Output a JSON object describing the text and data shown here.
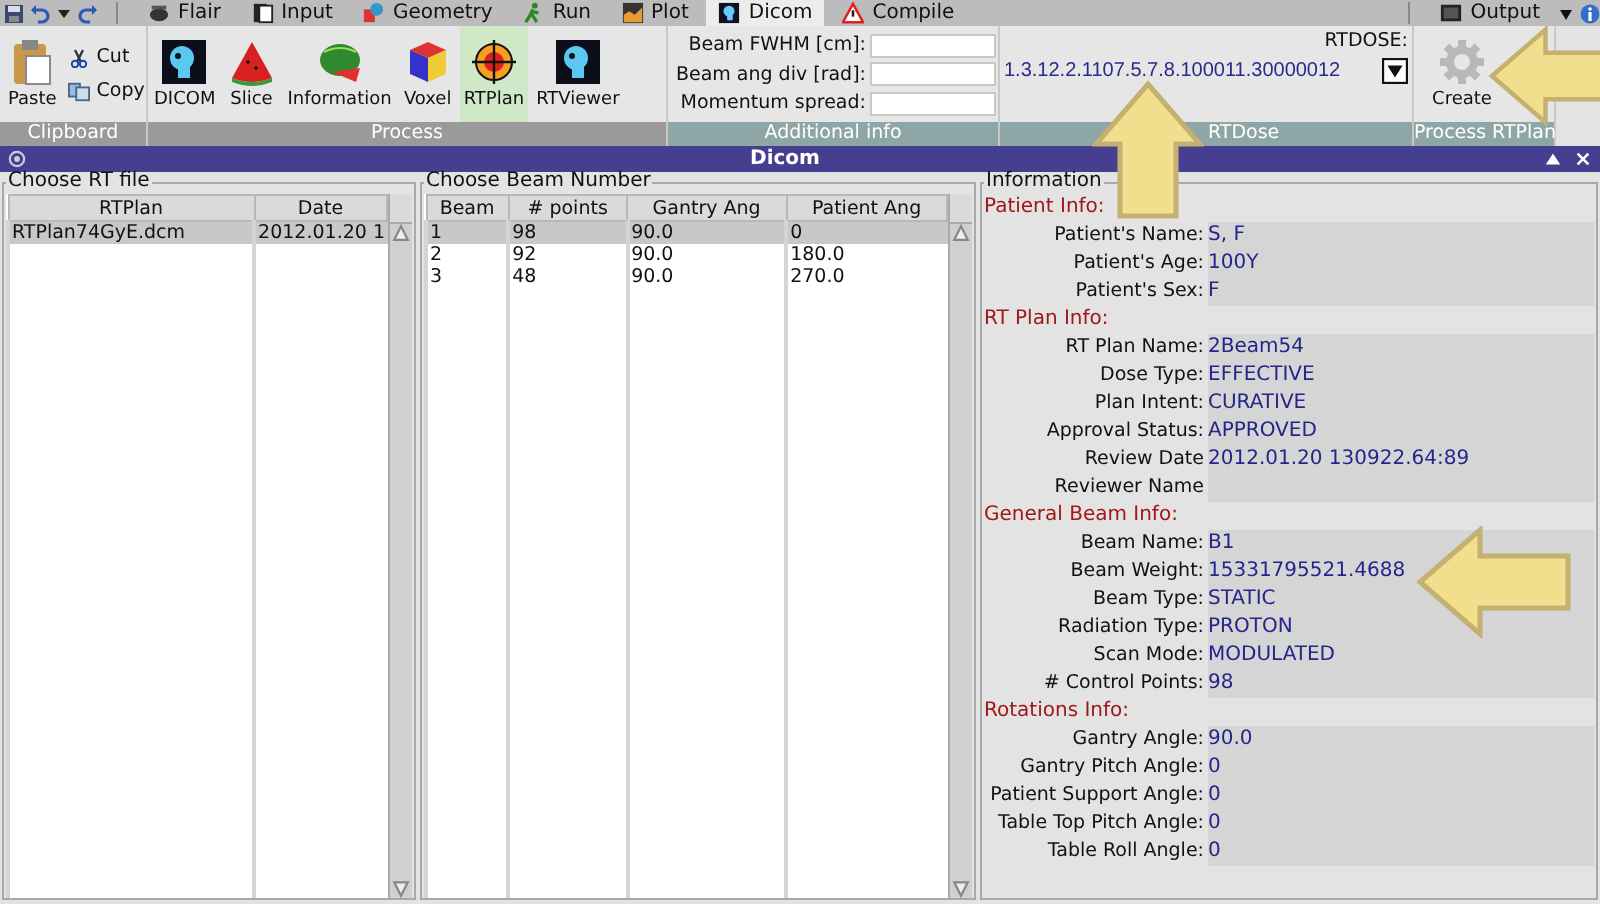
{
  "tabs": [
    {
      "label": "Flair",
      "selected": false
    },
    {
      "label": "Input",
      "selected": false
    },
    {
      "label": "Geometry",
      "selected": false
    },
    {
      "label": "Run",
      "selected": false
    },
    {
      "label": "Plot",
      "selected": false
    },
    {
      "label": "Dicom",
      "selected": true
    },
    {
      "label": "Compile",
      "selected": false
    }
  ],
  "output_tab": {
    "label": "Output"
  },
  "ribbon": {
    "clipboard": {
      "title": "Clipboard",
      "paste": "Paste",
      "cut": "Cut",
      "copy": "Copy"
    },
    "process": {
      "title": "Process",
      "buttons": [
        {
          "label": "DICOM",
          "selected": false
        },
        {
          "label": "Slice",
          "selected": false
        },
        {
          "label": "Information",
          "selected": false
        },
        {
          "label": "Voxel",
          "selected": false
        },
        {
          "label": "RTPlan",
          "selected": true
        },
        {
          "label": "RTViewer",
          "selected": false
        }
      ]
    },
    "additional_info": {
      "title": "Additional info",
      "fields": [
        {
          "label": "Beam FWHM [cm]:"
        },
        {
          "label": "Beam ang div [rad]:"
        },
        {
          "label": "Momentum spread:"
        }
      ]
    },
    "rtdose": {
      "title": "RTDose",
      "label": "RTDOSE:",
      "value": "1.3.12.2.1107.5.7.8.100011.30000012"
    },
    "process_rtplan": {
      "title": "Process RTPlan",
      "button": "Create"
    }
  },
  "window": {
    "title": "Dicom"
  },
  "rt_file": {
    "title": "Choose RT file",
    "columns": [
      "RTPlan",
      "Date"
    ],
    "rows": [
      {
        "cells": [
          "RTPlan74GyE.dcm",
          "2012.01.20 1"
        ],
        "selected": true
      }
    ]
  },
  "beams": {
    "title": "Choose Beam Number",
    "columns": [
      "Beam",
      "# points",
      "Gantry Ang",
      "Patient Ang"
    ],
    "rows": [
      {
        "cells": [
          "1",
          "98",
          "90.0",
          "0"
        ],
        "selected": true
      },
      {
        "cells": [
          "2",
          "92",
          "90.0",
          "180.0"
        ],
        "selected": false
      },
      {
        "cells": [
          "3",
          "48",
          "90.0",
          "270.0"
        ],
        "selected": false
      }
    ]
  },
  "information": {
    "title": "Information",
    "sections": [
      {
        "title": "Patient Info:",
        "rows": [
          {
            "label": "Patient's Name:",
            "value": "S, F"
          },
          {
            "label": "Patient's Age:",
            "value": "100Y"
          },
          {
            "label": "Patient's Sex:",
            "value": "F"
          }
        ]
      },
      {
        "title": "RT Plan Info:",
        "rows": [
          {
            "label": "RT Plan Name:",
            "value": "2Beam54"
          },
          {
            "label": "Dose Type:",
            "value": "EFFECTIVE"
          },
          {
            "label": "Plan Intent:",
            "value": "CURATIVE"
          },
          {
            "label": "Approval Status:",
            "value": "APPROVED"
          },
          {
            "label": "Review Date",
            "value": "2012.01.20 130922.64:89"
          },
          {
            "label": "Reviewer Name"
          }
        ]
      },
      {
        "title": "General Beam Info:",
        "rows": [
          {
            "label": "Beam Name:",
            "value": "B1"
          },
          {
            "label": "Beam Weight:",
            "value": "15331795521.4688"
          },
          {
            "label": "Beam Type:",
            "value": "STATIC"
          },
          {
            "label": "Radiation Type:",
            "value": "PROTON"
          },
          {
            "label": "Scan Mode:",
            "value": "MODULATED"
          },
          {
            "label": "# Control Points:",
            "value": "98"
          }
        ]
      },
      {
        "title": "Rotations Info:",
        "rows": [
          {
            "label": "Gantry Angle:",
            "value": "90.0"
          },
          {
            "label": "Gantry Pitch Angle:",
            "value": "0"
          },
          {
            "label": "Patient Support Angle:",
            "value": "0"
          },
          {
            "label": "Table Top Pitch Angle:",
            "value": "0"
          },
          {
            "label": "Table Roll Angle:",
            "value": "0"
          }
        ]
      }
    ]
  }
}
